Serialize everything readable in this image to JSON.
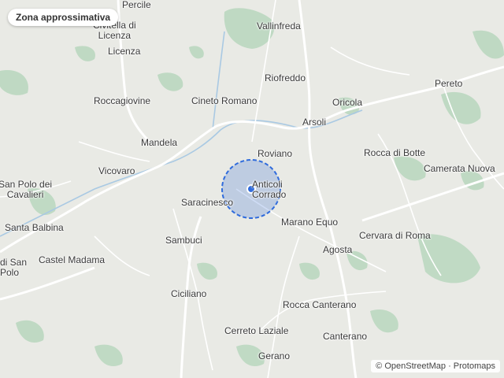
{
  "badge": {
    "label": "Zona approssimativa"
  },
  "attribution": {
    "copyright": "©",
    "osm": "OpenStreetMap",
    "separator": "·",
    "protomaps": "Protomaps"
  },
  "colors": {
    "land": "#e9eae5",
    "forest": "#b6d6bd",
    "road": "#ffffff",
    "area_fill": "#3f73d6",
    "marker": "#2f6bdc"
  },
  "places": {
    "percile": "Percile",
    "civitella_1": "Civitella di",
    "civitella_2": "Licenza",
    "licenza": "Licenza",
    "vallinfreda": "Vallinfreda",
    "riofreddo": "Riofreddo",
    "pereto": "Pereto",
    "roccagiovine": "Roccagiovine",
    "cineto": "Cineto Romano",
    "oricola": "Oricola",
    "arsoli": "Arsoli",
    "mandela": "Mandela",
    "roviano": "Roviano",
    "rocca_botte": "Rocca di Botte",
    "vicovaro": "Vicovaro",
    "camerata": "Camerata Nuova",
    "san_polo_cav_1": "San Polo dei",
    "san_polo_cav_2": "Cavalieri",
    "anticoli_1": "Anticoli",
    "anticoli_2": "Corrado",
    "saracinesco": "Saracinesco",
    "marano": "Marano Equo",
    "santa_balbina": "Santa Balbina",
    "cervara": "Cervara di Roma",
    "sambuci": "Sambuci",
    "agosta": "Agosta",
    "castel_madama": "Castel Madama",
    "san_polo_1": "di San",
    "san_polo_2": "Polo",
    "ciciliano": "Ciciliano",
    "rocca_canterano": "Rocca Canterano",
    "cerreto": "Cerreto Laziale",
    "canterano": "Canterano",
    "gerano": "Gerano"
  }
}
